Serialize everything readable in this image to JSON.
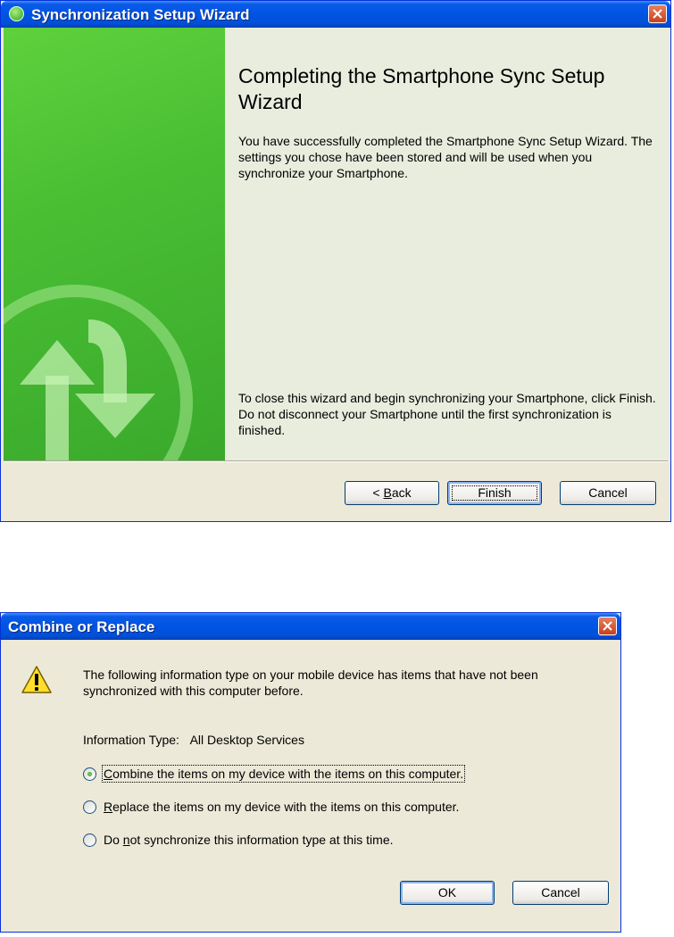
{
  "wizard": {
    "title": "Synchronization Setup Wizard",
    "heading": "Completing the Smartphone Sync Setup Wizard",
    "paragraph1": "You have successfully completed the Smartphone Sync Setup Wizard.  The settings you chose have been stored and will be used when you synchronize your Smartphone.",
    "paragraph2": "To close this wizard and begin synchronizing your Smartphone, click Finish.  Do not disconnect your Smartphone until the first synchronization is finished.",
    "buttons": {
      "back_prefix": "< ",
      "back_mnemonic": "B",
      "back_rest": "ack",
      "finish": "Finish",
      "cancel": "Cancel"
    },
    "colors": {
      "side_panel": "#4cc036",
      "content_bg": "#e8edde"
    }
  },
  "dialog": {
    "title": "Combine or Replace",
    "message": "The following information type on your mobile device has items that have not been synchronized with this computer before.",
    "info_type_label": "Information Type:",
    "info_type_value": "All Desktop Services",
    "options": [
      {
        "mnemonic": "C",
        "rest": "ombine the items on my device with the items on this computer.",
        "checked": true
      },
      {
        "mnemonic": "R",
        "rest": "eplace the items on my device with the items on this computer.",
        "checked": false
      },
      {
        "prefix": "Do ",
        "mnemonic": "n",
        "rest": "ot synchronize this information type at this time.",
        "checked": false
      }
    ],
    "buttons": {
      "ok": "OK",
      "cancel": "Cancel"
    },
    "icons": {
      "warning": "warning-icon",
      "close": "close-icon"
    }
  }
}
